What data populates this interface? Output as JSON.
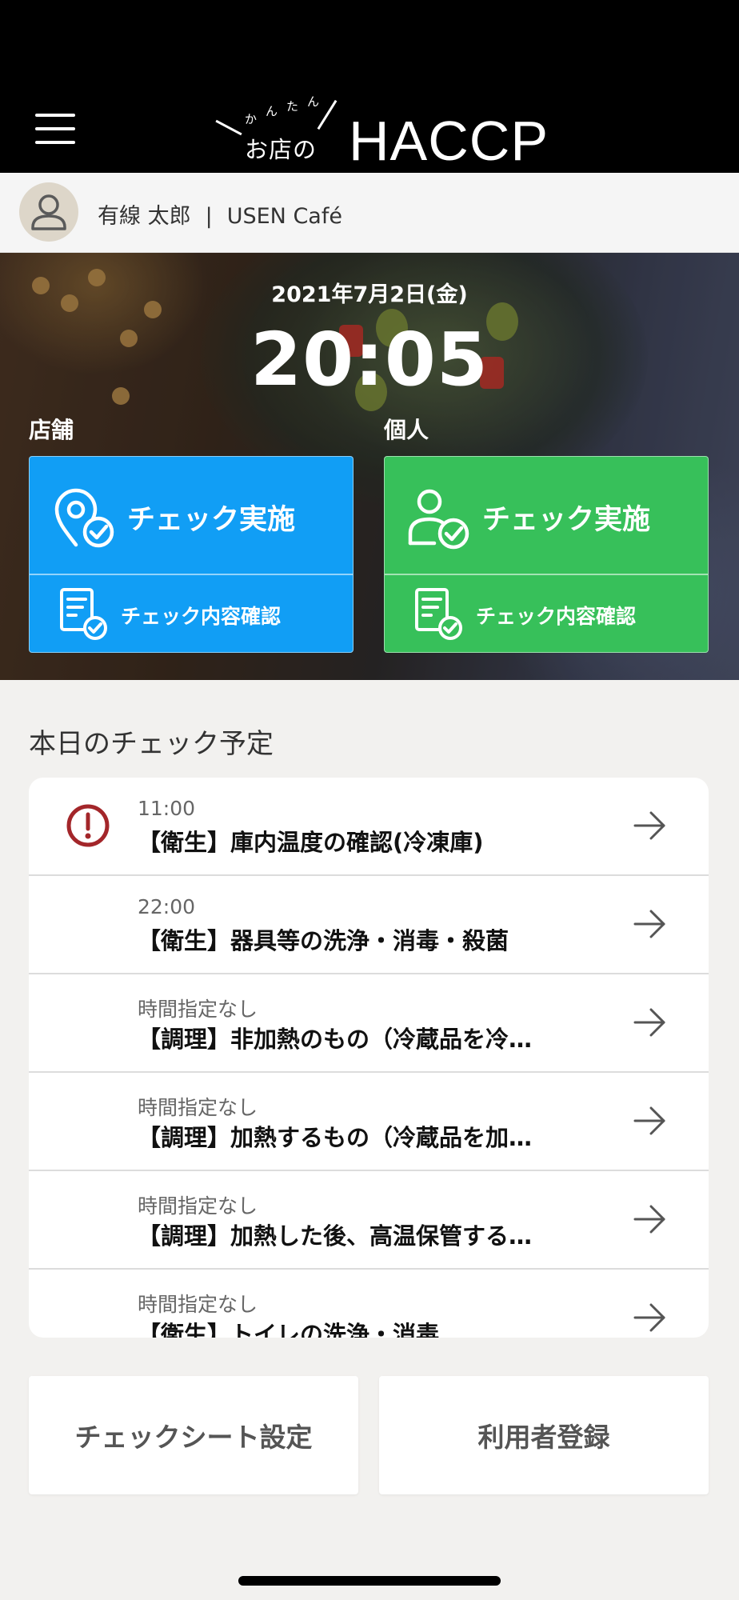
{
  "header": {
    "logo_ruby": [
      "か",
      "ん",
      "た",
      "ん"
    ],
    "logo_main": "お店の",
    "logo_brand": "HACCP",
    "menu_icon": "hamburger-menu-icon"
  },
  "user": {
    "name": "有線 太郎",
    "separator": "|",
    "shop": "USEN Café",
    "avatar_icon": "user-avatar-icon"
  },
  "hero": {
    "date": "2021年7月2日(金)",
    "time": "20:05",
    "store_label": "店舗",
    "personal_label": "個人",
    "store_card": {
      "primary_label": "チェック実施",
      "secondary_label": "チェック内容確認",
      "primary_icon": "location-check-icon",
      "secondary_icon": "document-check-icon",
      "color": "#119ef5"
    },
    "personal_card": {
      "primary_label": "チェック実施",
      "secondary_label": "チェック内容確認",
      "primary_icon": "person-check-icon",
      "secondary_icon": "document-check-icon",
      "color": "#37c05a"
    }
  },
  "schedule": {
    "title": "本日のチェック予定",
    "items": [
      {
        "when": "11:00",
        "task": "【衛生】庫内温度の確認(冷凍庫)",
        "alert": true
      },
      {
        "when": "22:00",
        "task": "【衛生】器具等の洗浄・消毒・殺菌",
        "alert": false
      },
      {
        "when": "時間指定なし",
        "task": "【調理】非加熱のもの（冷蔵品を冷…",
        "alert": false
      },
      {
        "when": "時間指定なし",
        "task": "【調理】加熱するもの（冷蔵品を加…",
        "alert": false
      },
      {
        "when": "時間指定なし",
        "task": "【調理】加熱した後、高温保管する…",
        "alert": false
      },
      {
        "when": "時間指定なし",
        "task": "【衛生】トイレの洗浄・消毒",
        "alert": false
      }
    ],
    "alert_color": "#a3262a"
  },
  "bottom": {
    "checksheet_label": "チェックシート設定",
    "register_label": "利用者登録"
  }
}
